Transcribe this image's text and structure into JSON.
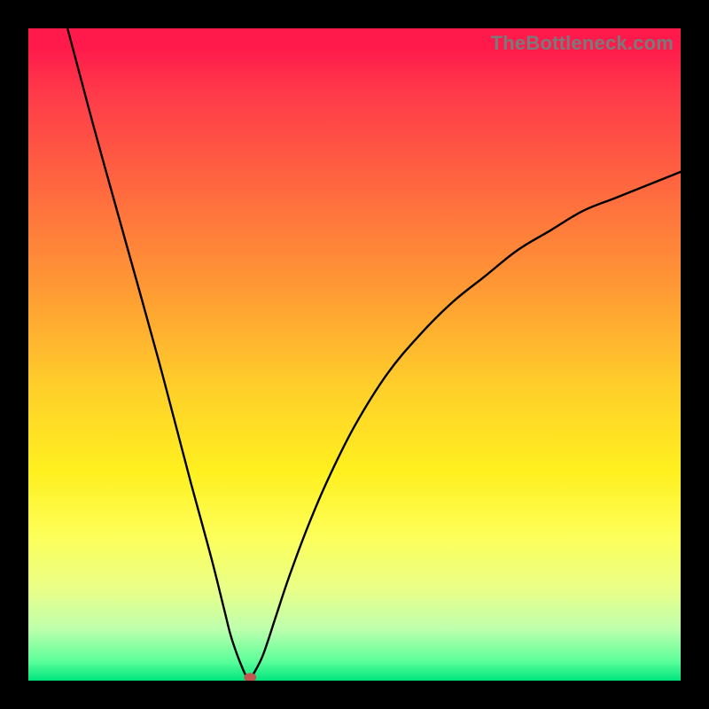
{
  "watermark": "TheBottleneck.com",
  "chart_data": {
    "type": "line",
    "title": "",
    "xlabel": "",
    "ylabel": "",
    "xlim": [
      0,
      100
    ],
    "ylim": [
      0,
      100
    ],
    "grid": false,
    "legend": false,
    "notes": "V-shaped bottleneck curve; background gradient from red (high, bad) through yellow to green (low, good). Minimum (optimal point) marked with a dot.",
    "background_gradient": {
      "top": "#ff1a4b",
      "mid": "#ffea2a",
      "bottom": "#00e57f"
    },
    "series": [
      {
        "name": "left-branch",
        "x": [
          6,
          10,
          15,
          20,
          25,
          28,
          30,
          31,
          32,
          33,
          33.5
        ],
        "y": [
          100,
          85,
          67,
          49,
          30,
          19,
          11,
          7,
          4,
          1.5,
          0.5
        ]
      },
      {
        "name": "right-branch",
        "x": [
          34.5,
          36,
          38,
          40,
          43,
          46,
          50,
          55,
          60,
          65,
          70,
          75,
          80,
          85,
          90,
          95,
          100
        ],
        "y": [
          1,
          4,
          10,
          16,
          24,
          31,
          39,
          47,
          53,
          58,
          62,
          66,
          69,
          72,
          74,
          76,
          78
        ]
      }
    ],
    "minimum_point": {
      "x": 34,
      "y": 0.5
    }
  }
}
